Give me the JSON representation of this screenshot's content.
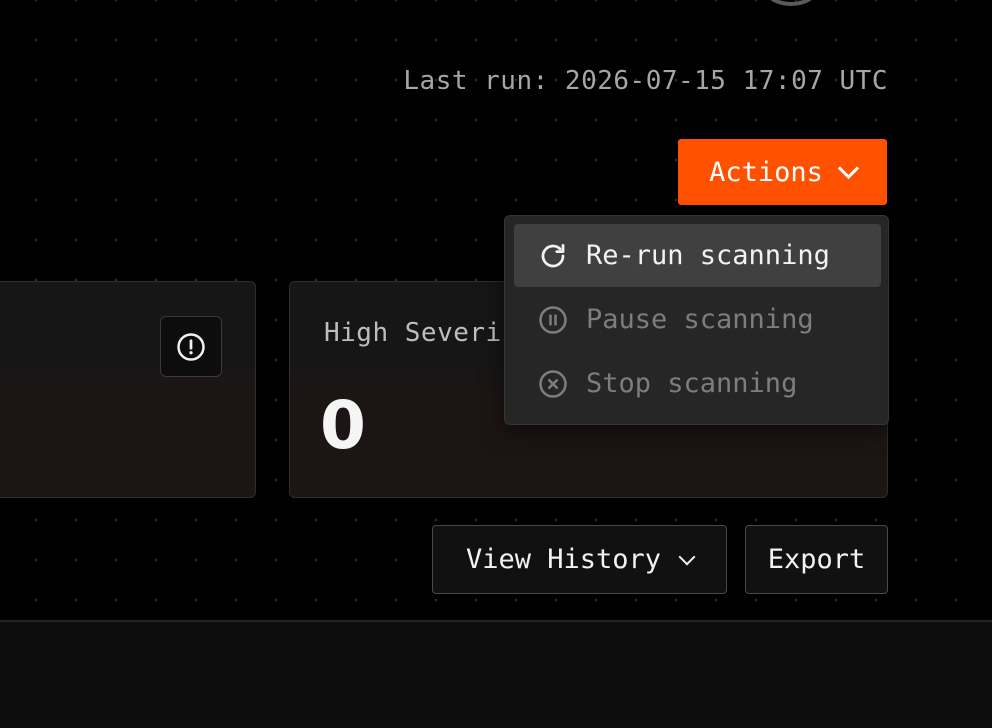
{
  "header": {
    "last_run": "Last run: 2026-07-15 17:07 UTC"
  },
  "actions": {
    "label": "Actions",
    "accent_color": "#ff5100",
    "menu": [
      {
        "label": "Re-run scanning",
        "icon": "refresh-icon",
        "state": "highlighted"
      },
      {
        "label": "Pause scanning",
        "icon": "pause-circle-icon",
        "state": "disabled"
      },
      {
        "label": "Stop scanning",
        "icon": "stop-circle-icon",
        "state": "disabled"
      }
    ]
  },
  "cards": {
    "left": {
      "icon": "alert-circle-icon"
    },
    "right": {
      "title": "High Severi",
      "value": "0"
    }
  },
  "footer_buttons": {
    "history_label": "View History",
    "export_label": "Export"
  }
}
